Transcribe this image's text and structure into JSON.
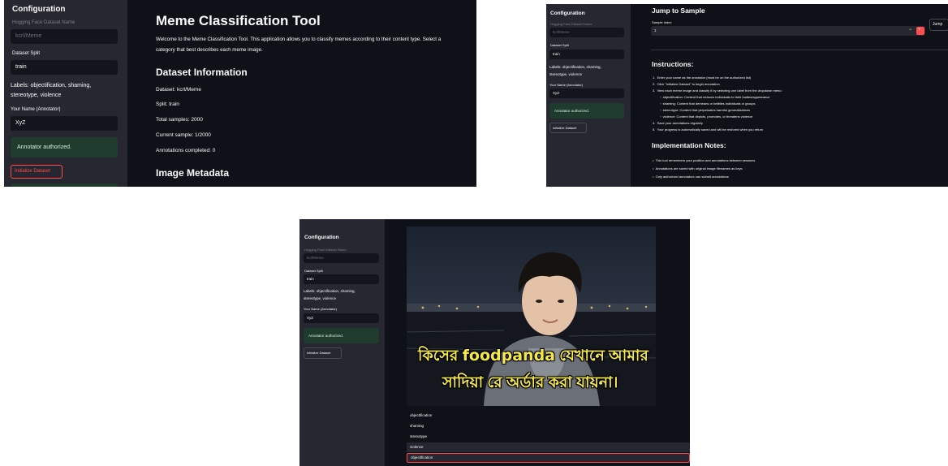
{
  "panel1": {
    "sidebar": {
      "title": "Configuration",
      "dataset_label": "Hugging Face Dataset Name",
      "dataset_value": "kcrl/Meme",
      "split_label": "Dataset Split",
      "split_value": "train",
      "labels_text_line1": "Labels: objectification, shaming,",
      "labels_text_line2": "stereotype, violence",
      "name_label": "Your Name (Annotator)",
      "name_value": "XyZ",
      "auth_message": "Annotator authorized.",
      "init_button": "Initialize Dataset"
    },
    "main": {
      "title": "Meme Classification Tool",
      "intro_line1": "Welcome to the Meme Classification Tool. This application allows you to classify memes according to their content type. Select a",
      "intro_line2": "category that best describes each meme image.",
      "info_heading": "Dataset Information",
      "dataset_line": "Dataset: kcrl/Meme",
      "split_line": "Split: train",
      "total_line": "Total samples: 2000",
      "current_line": "Current sample: 1/2000",
      "annotations_line": "Annotations completed: 0",
      "metadata_heading": "Image Metadata"
    }
  },
  "panel2": {
    "sidebar": {
      "title": "Configuration",
      "dataset_label": "Hugging Face Dataset Name",
      "dataset_value": "kcrl/Meme",
      "split_label": "Dataset Split",
      "split_value": "train",
      "labels_text_line1": "Labels: objectification, shaming,",
      "labels_text_line2": "stereotype, violence",
      "name_label": "Your Name (Annotator)",
      "name_value": "XyZ",
      "auth_message": "Annotator authorized.",
      "init_button": "Initialize Dataset"
    },
    "main": {
      "jump_heading": "Jump to Sample",
      "sample_index_label": "Sample Index",
      "sample_index_value": "1",
      "minus": "−",
      "plus": "+",
      "jump_button": "Jump",
      "instructions_heading": "Instructions:",
      "steps": [
        "Enter your name as the annotator (must be on the authorized list)",
        "Click \"Initialize Dataset\" to begin annotation",
        "View each meme image and classify it by selecting one label from the dropdown menu:",
        "Save your annotations regularly",
        "Your progress is automatically saved and will be restored when you return"
      ],
      "substeps": [
        "objectification: Content that reduces individuals to their bodies/appearance",
        "shaming: Content that demeans or belittles individuals or groups",
        "stereotype: Content that perpetuates harmful generalizations",
        "violence: Content that depicts, promotes, or threatens violence"
      ],
      "impl_heading": "Implementation Notes:",
      "notes": [
        "This tool remembers your position and annotations between sessions",
        "Annotations are saved with original image filenames as keys",
        "Only authorized annotators can submit annotations"
      ]
    }
  },
  "panel3": {
    "sidebar": {
      "title": "Configuration",
      "dataset_label": "Hugging Face Dataset Name",
      "dataset_value": "kcrl/Meme",
      "split_label": "Dataset Split",
      "split_value": "train",
      "labels_text_line1": "Labels: objectification, shaming,",
      "labels_text_line2": "stereotype, violence",
      "name_label": "Your Name (Annotator)",
      "name_value": "XyZ",
      "auth_message": "Annotator authorized.",
      "init_button": "Initialize Dataset"
    },
    "meme": {
      "caption_word1": "কিসের",
      "caption_brand": "foodpanda",
      "caption_word2": "যেখানে আমার",
      "caption_line2": "সাদিয়া রে অর্ডার করা যায়না।"
    },
    "dropdown_options": [
      "objectification",
      "shaming",
      "stereotype",
      "violence"
    ],
    "selected_value": "objectification"
  },
  "colors": {
    "sidebar_bg": "#262730",
    "main_bg": "#0e1117",
    "success_bg": "#1f3b2d",
    "accent_red": "#ff4b4b"
  }
}
